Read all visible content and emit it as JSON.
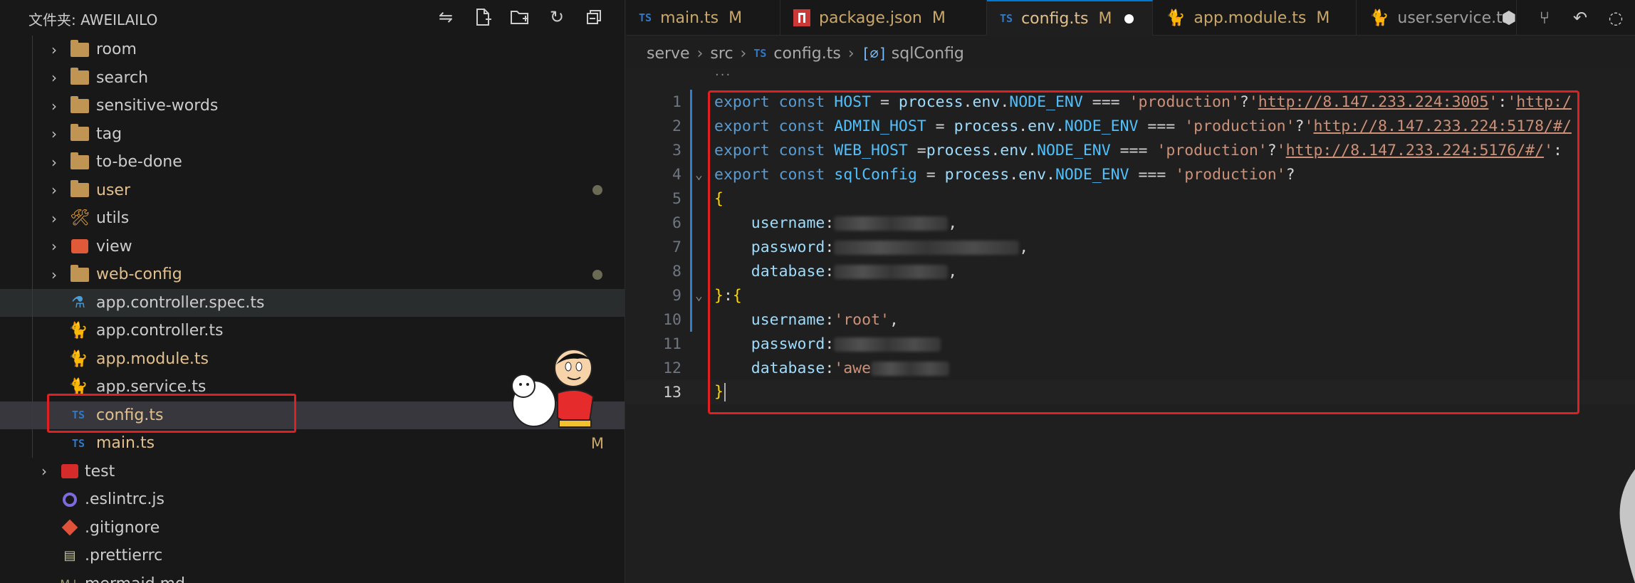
{
  "explorer": {
    "title": "文件夹: AWEILAILO",
    "actions": [
      "compare-icon",
      "new-file-icon",
      "new-folder-icon",
      "refresh-icon",
      "collapse-all-icon"
    ],
    "items": [
      {
        "label": "room",
        "type": "folder",
        "depth": 1,
        "expandable": true,
        "color": "#cccccc"
      },
      {
        "label": "search",
        "type": "folder",
        "depth": 1,
        "expandable": true,
        "color": "#cccccc"
      },
      {
        "label": "sensitive-words",
        "type": "folder",
        "depth": 1,
        "expandable": true,
        "color": "#cccccc"
      },
      {
        "label": "tag",
        "type": "folder",
        "depth": 1,
        "expandable": true,
        "color": "#cccccc"
      },
      {
        "label": "to-be-done",
        "type": "folder",
        "depth": 1,
        "expandable": true,
        "color": "#cccccc"
      },
      {
        "label": "user",
        "type": "folder",
        "depth": 1,
        "expandable": true,
        "color": "#e2c08d",
        "modified_dot": true
      },
      {
        "label": "utils",
        "type": "utils-folder",
        "depth": 1,
        "expandable": true,
        "color": "#cccccc"
      },
      {
        "label": "view",
        "type": "view-folder",
        "depth": 1,
        "expandable": true,
        "color": "#cccccc"
      },
      {
        "label": "web-config",
        "type": "folder",
        "depth": 1,
        "expandable": true,
        "color": "#e2c08d",
        "modified_dot": true
      },
      {
        "label": "app.controller.spec.ts",
        "type": "spec",
        "depth": 1,
        "color": "#cccccc"
      },
      {
        "label": "app.controller.ts",
        "type": "nest",
        "depth": 1,
        "color": "#cccccc"
      },
      {
        "label": "app.module.ts",
        "type": "nest",
        "depth": 1,
        "color": "#e2c08d"
      },
      {
        "label": "app.service.ts",
        "type": "nest",
        "depth": 1,
        "color": "#cccccc"
      },
      {
        "label": "config.ts",
        "type": "ts",
        "depth": 1,
        "color": "#e2c08d",
        "active": true
      },
      {
        "label": "main.ts",
        "type": "ts",
        "depth": 1,
        "color": "#e2c08d",
        "badge": "M"
      },
      {
        "label": "test",
        "type": "test-folder",
        "depth": 0,
        "expandable": true,
        "color": "#cccccc"
      },
      {
        "label": ".eslintrc.js",
        "type": "eslint",
        "depth": 0,
        "color": "#cccccc"
      },
      {
        "label": ".gitignore",
        "type": "git",
        "depth": 0,
        "color": "#cccccc"
      },
      {
        "label": ".prettierrc",
        "type": "prettier",
        "depth": 0,
        "color": "#cccccc"
      },
      {
        "label": "mermaid.md",
        "type": "md",
        "depth": 0,
        "color": "#cccccc"
      }
    ]
  },
  "tabs": [
    {
      "label": "main.ts",
      "icon": "ts",
      "badge": "M"
    },
    {
      "label": "package.json",
      "icon": "npm",
      "badge": "M"
    },
    {
      "label": "config.ts",
      "icon": "ts",
      "badge": "M",
      "active": true,
      "unsaved": true
    },
    {
      "label": "app.module.ts",
      "icon": "nest",
      "badge": "M"
    },
    {
      "label": "user.service.ts",
      "icon": "nest",
      "badge": ""
    }
  ],
  "breadcrumb": {
    "parts": [
      "serve",
      "src",
      "config.ts",
      "sqlConfig"
    ],
    "ts_badge": "TS",
    "symbol_icon": "[⌀]"
  },
  "editor": {
    "ellipsis": "···",
    "current_line": 13,
    "lines": [
      {
        "n": "1",
        "segments": [
          [
            "k",
            "export "
          ],
          [
            "k",
            "const "
          ],
          [
            "v",
            "HOST "
          ],
          [
            "op",
            "= "
          ],
          [
            "p",
            "process"
          ],
          [
            "op",
            "."
          ],
          [
            "p",
            "env"
          ],
          [
            "op",
            "."
          ],
          [
            "v",
            "NODE_ENV "
          ],
          [
            "op",
            "=== "
          ],
          [
            "s",
            "'production'"
          ],
          [
            "op",
            "?"
          ],
          [
            "s",
            "'"
          ],
          [
            "u",
            "http://8.147.233.224:3005"
          ],
          [
            "s",
            "'"
          ],
          [
            "op",
            ":"
          ],
          [
            "s",
            "'"
          ],
          [
            "u",
            "http:/"
          ]
        ]
      },
      {
        "n": "2",
        "segments": [
          [
            "k",
            "export "
          ],
          [
            "k",
            "const "
          ],
          [
            "v",
            "ADMIN_HOST "
          ],
          [
            "op",
            "= "
          ],
          [
            "p",
            "process"
          ],
          [
            "op",
            "."
          ],
          [
            "p",
            "env"
          ],
          [
            "op",
            "."
          ],
          [
            "v",
            "NODE_ENV "
          ],
          [
            "op",
            "=== "
          ],
          [
            "s",
            "'production'"
          ],
          [
            "op",
            "?"
          ],
          [
            "s",
            "'"
          ],
          [
            "u",
            "http://8.147.233.224:5178/#/"
          ]
        ]
      },
      {
        "n": "3",
        "segments": [
          [
            "k",
            "export "
          ],
          [
            "k",
            "const "
          ],
          [
            "v",
            "WEB_HOST "
          ],
          [
            "op",
            "="
          ],
          [
            "p",
            "process"
          ],
          [
            "op",
            "."
          ],
          [
            "p",
            "env"
          ],
          [
            "op",
            "."
          ],
          [
            "v",
            "NODE_ENV "
          ],
          [
            "op",
            "=== "
          ],
          [
            "s",
            "'production'"
          ],
          [
            "op",
            "?"
          ],
          [
            "s",
            "'"
          ],
          [
            "u",
            "http://8.147.233.224:5176/#/"
          ],
          [
            "s",
            "'"
          ],
          [
            "op",
            ":"
          ]
        ]
      },
      {
        "n": "4",
        "fold": true,
        "segments": [
          [
            "k",
            "export "
          ],
          [
            "k",
            "const "
          ],
          [
            "v",
            "sqlConfig "
          ],
          [
            "op",
            "= "
          ],
          [
            "p",
            "process"
          ],
          [
            "op",
            "."
          ],
          [
            "p",
            "env"
          ],
          [
            "op",
            "."
          ],
          [
            "v",
            "NODE_ENV "
          ],
          [
            "op",
            "=== "
          ],
          [
            "s",
            "'production'"
          ],
          [
            "op",
            "?"
          ]
        ]
      },
      {
        "n": "5",
        "segments": [
          [
            "b1",
            "{"
          ]
        ]
      },
      {
        "n": "6",
        "segments": [
          [
            "op",
            "    "
          ],
          [
            "p",
            "username"
          ],
          [
            "op",
            ":"
          ],
          [
            "blur",
            "160"
          ],
          [
            "op",
            ","
          ]
        ]
      },
      {
        "n": "7",
        "segments": [
          [
            "op",
            "    "
          ],
          [
            "p",
            "password"
          ],
          [
            "op",
            ":"
          ],
          [
            "blur",
            "260"
          ],
          [
            "op",
            ","
          ]
        ]
      },
      {
        "n": "8",
        "segments": [
          [
            "op",
            "    "
          ],
          [
            "p",
            "database"
          ],
          [
            "op",
            ":"
          ],
          [
            "blur",
            "160"
          ],
          [
            "op",
            ","
          ]
        ]
      },
      {
        "n": "9",
        "fold": true,
        "segments": [
          [
            "b1",
            "}"
          ],
          [
            "op",
            ":"
          ],
          [
            "b1",
            "{"
          ]
        ]
      },
      {
        "n": "10",
        "segments": [
          [
            "op",
            "    "
          ],
          [
            "p",
            "username"
          ],
          [
            "op",
            ":"
          ],
          [
            "s",
            "'root'"
          ],
          [
            "op",
            ","
          ]
        ]
      },
      {
        "n": "11",
        "segments": [
          [
            "op",
            "    "
          ],
          [
            "p",
            "password"
          ],
          [
            "op",
            ":"
          ],
          [
            "blur",
            "150"
          ]
        ]
      },
      {
        "n": "12",
        "segments": [
          [
            "op",
            "    "
          ],
          [
            "p",
            "database"
          ],
          [
            "op",
            ":"
          ],
          [
            "s",
            "'awe"
          ],
          [
            "blur",
            "110"
          ]
        ]
      },
      {
        "n": "13",
        "segments": [
          [
            "b1",
            "}"
          ],
          [
            "cursor",
            ""
          ]
        ]
      }
    ]
  },
  "colors": {
    "accent": "#0078d4",
    "highlight_box": "#e02020",
    "modified": "#e2c08d"
  }
}
